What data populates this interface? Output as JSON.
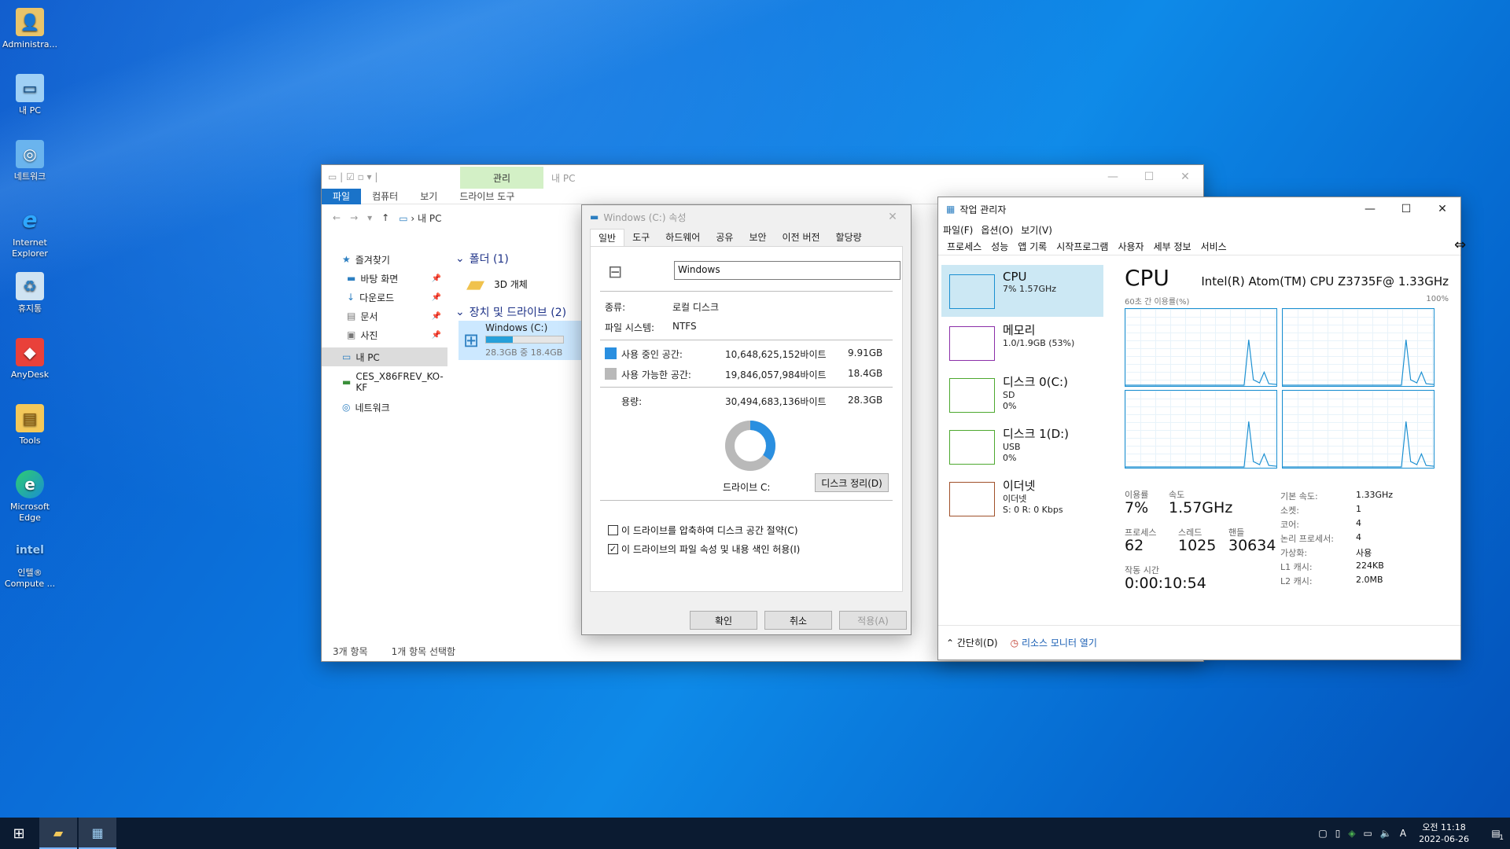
{
  "desktop": {
    "icons": [
      {
        "label": "Administra...",
        "icon": "user-folder-icon"
      },
      {
        "label": "내 PC",
        "icon": "computer-icon"
      },
      {
        "label": "네트워크",
        "icon": "network-icon"
      },
      {
        "label": "Internet Explorer",
        "icon": "internet-explorer-icon"
      },
      {
        "label": "휴지통",
        "icon": "recycle-bin-icon"
      },
      {
        "label": "AnyDesk",
        "icon": "anydesk-icon"
      },
      {
        "label": "Tools",
        "icon": "folder-icon"
      },
      {
        "label": "Microsoft Edge",
        "icon": "edge-icon"
      },
      {
        "label": "인텔® Compute ...",
        "icon": "intel-icon"
      }
    ]
  },
  "explorer": {
    "title": "내 PC",
    "manage_tab": "관리",
    "ribbon": {
      "file": "파일",
      "computer": "컴퓨터",
      "view": "보기",
      "drive_tools": "드라이브 도구"
    },
    "address": "내 PC",
    "nav": {
      "quick_access": "즐겨찾기",
      "desktop": "바탕 화면",
      "downloads": "다운로드",
      "documents": "문서",
      "pictures": "사진",
      "this_pc": "내 PC",
      "usb": "CES_X86FREV_KO-KF",
      "network": "네트워크"
    },
    "folders_header": "폴더 (1)",
    "folder_3d": "3D 개체",
    "drives_header": "장치 및 드라이브 (2)",
    "drive_c": {
      "name": "Windows (C:)",
      "size": "28.3GB 중 18.4GB",
      "used_fraction": 0.35
    },
    "status": {
      "items": "3개 항목",
      "selected": "1개 항목 선택함"
    }
  },
  "props": {
    "title": "Windows (C:) 속성",
    "tabs": [
      "일반",
      "도구",
      "하드웨어",
      "공유",
      "보안",
      "이전 버전",
      "할당량"
    ],
    "name_value": "Windows",
    "type_label": "종류:",
    "type_value": "로컬 디스크",
    "fs_label": "파일 시스템:",
    "fs_value": "NTFS",
    "used_label": "사용 중인 공간:",
    "used_bytes": "10,648,625,152바이트",
    "used_gb": "9.91GB",
    "free_label": "사용 가능한 공간:",
    "free_bytes": "19,846,057,984바이트",
    "free_gb": "18.4GB",
    "cap_label": "용량:",
    "cap_bytes": "30,494,683,136바이트",
    "cap_gb": "28.3GB",
    "used_fraction": 0.349,
    "drive_label": "드라이브 C:",
    "cleanup_btn": "디스크 정리(D)",
    "compress_label": "이 드라이브를 압축하여 디스크 공간 절약(C)",
    "index_label": "이 드라이브의 파일 속성 및 내용 색인 허용(I)",
    "ok": "확인",
    "cancel": "취소",
    "apply": "적용(A)",
    "colors": {
      "used": "#2a8fe0",
      "free": "#b9b9b9"
    }
  },
  "taskmgr": {
    "title": "작업 관리자",
    "menu": [
      "파일(F)",
      "옵션(O)",
      "보기(V)"
    ],
    "tabs": [
      "프로세스",
      "성능",
      "앱 기록",
      "시작프로그램",
      "사용자",
      "세부 정보",
      "서비스"
    ],
    "resources": [
      {
        "name": "CPU",
        "line1": "7% 1.57GHz",
        "line2": "",
        "color": "#1a8fd1"
      },
      {
        "name": "메모리",
        "line1": "1.0/1.9GB (53%)",
        "line2": "",
        "color": "#8b2fa8"
      },
      {
        "name": "디스크 0(C:)",
        "line1": "SD",
        "line2": "0%",
        "color": "#4da82f"
      },
      {
        "name": "디스크 1(D:)",
        "line1": "USB",
        "line2": "0%",
        "color": "#4da82f"
      },
      {
        "name": "이더넷",
        "line1": "이더넷",
        "line2": "S: 0 R: 0 Kbps",
        "color": "#a0502a"
      }
    ],
    "heading": "CPU",
    "model": "Intel(R) Atom(TM) CPU Z3735F@ 1.33GHz",
    "graph_left": "60초 간 이용률(%)",
    "graph_right": "100%",
    "stats": {
      "util_label": "이용률",
      "util": "7%",
      "speed_label": "속도",
      "speed": "1.57GHz",
      "proc_label": "프로세스",
      "proc": "62",
      "threads_label": "스레드",
      "threads": "1025",
      "handles_label": "핸들",
      "handles": "30634",
      "uptime_label": "작동 시간",
      "uptime": "0:00:10:54"
    },
    "details": [
      {
        "k": "기본 속도:",
        "v": "1.33GHz"
      },
      {
        "k": "소켓:",
        "v": "1"
      },
      {
        "k": "코어:",
        "v": "4"
      },
      {
        "k": "논리 프로세서:",
        "v": "4"
      },
      {
        "k": "가상화:",
        "v": "사용"
      },
      {
        "k": "L1 캐시:",
        "v": "224KB"
      },
      {
        "k": "L2 캐시:",
        "v": "2.0MB"
      }
    ],
    "fewer_details": "간단히(D)",
    "resource_monitor": "리소스 모니터 열기"
  },
  "taskbar": {
    "time": "오전 11:18",
    "date": "2022-06-26",
    "ime": "A",
    "notifications": "1"
  }
}
